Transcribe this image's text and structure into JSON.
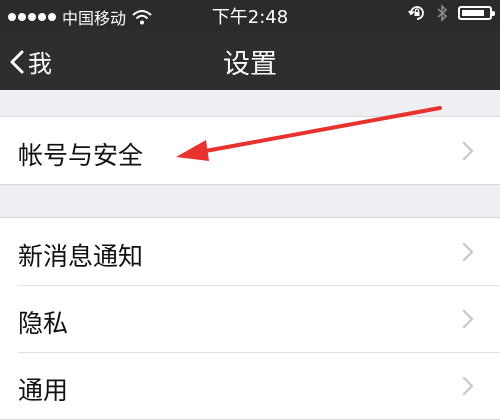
{
  "status_bar": {
    "carrier": "中国移动",
    "time": "下午2:48",
    "icons": [
      "signal-dots-icon",
      "wifi-icon",
      "rotation-lock-icon",
      "bluetooth-icon",
      "battery-icon"
    ],
    "battery_level": 0.85
  },
  "nav": {
    "back_label": "我",
    "title": "设置"
  },
  "settings": {
    "group1": [
      {
        "label": "帐号与安全"
      }
    ],
    "group2": [
      {
        "label": "新消息通知"
      },
      {
        "label": "隐私"
      },
      {
        "label": "通用"
      }
    ]
  },
  "annotation": {
    "type": "arrow",
    "color": "#e8322d",
    "target": "帐号与安全"
  },
  "colors": {
    "nav_background": "#2e2e30",
    "page_background": "#eeeef3",
    "row_background": "#ffffff",
    "chevron": "#c7c7cc"
  }
}
